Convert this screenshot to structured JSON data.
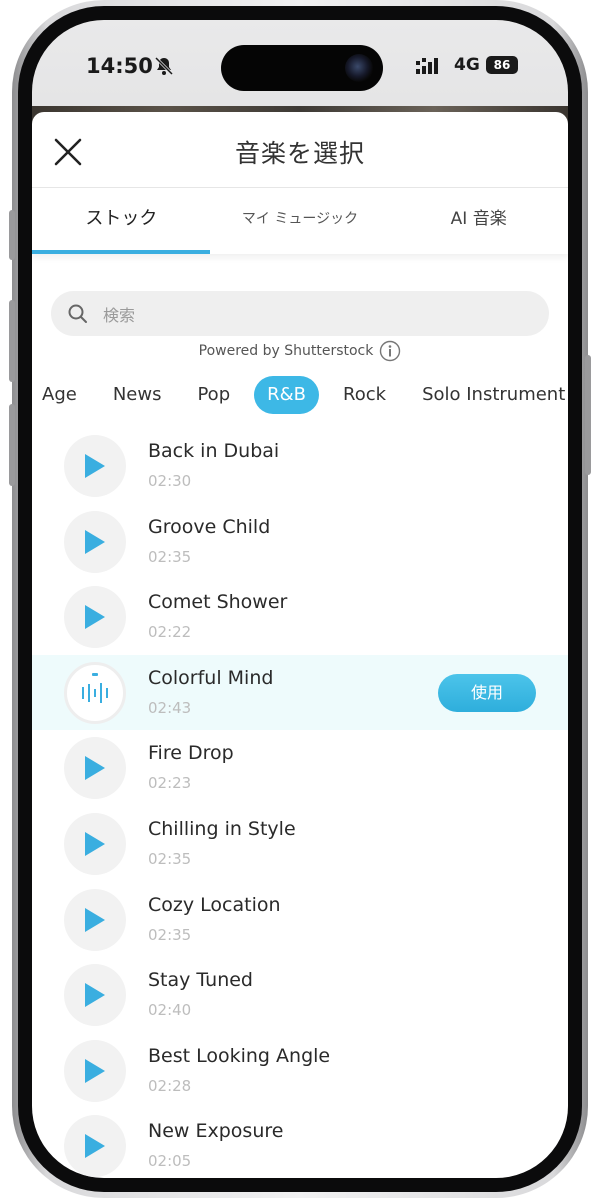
{
  "status_bar": {
    "time": "14:50",
    "network": "4G",
    "battery": "86"
  },
  "header": {
    "title": "音楽を選択"
  },
  "tabs": [
    {
      "label": "ストック",
      "active": true
    },
    {
      "label": "マイ ミュージック",
      "active": false
    },
    {
      "label": "AI 音楽",
      "active": false
    }
  ],
  "search": {
    "placeholder": "検索"
  },
  "powered_by": "Powered by Shutterstock",
  "genres": [
    "Age",
    "News",
    "Pop",
    "R&B",
    "Rock",
    "Solo Instrument"
  ],
  "selected_genre": "R&B",
  "tracks": [
    {
      "name": "Back in Dubai",
      "duration": "02:30"
    },
    {
      "name": "Groove Child",
      "duration": "02:35"
    },
    {
      "name": "Comet Shower",
      "duration": "02:22"
    },
    {
      "name": "Colorful Mind",
      "duration": "02:43",
      "playing": true
    },
    {
      "name": "Fire Drop",
      "duration": "02:23"
    },
    {
      "name": "Chilling in Style",
      "duration": "02:35"
    },
    {
      "name": "Cozy Location",
      "duration": "02:35"
    },
    {
      "name": "Stay Tuned",
      "duration": "02:40"
    },
    {
      "name": "Best Looking Angle",
      "duration": "02:28"
    },
    {
      "name": "New Exposure",
      "duration": "02:05"
    }
  ],
  "use_button_label": "使用",
  "colors": {
    "accent": "#3db8e6",
    "play_icon": "#3aaee0",
    "playing_row_bg": "#eefbfc"
  }
}
